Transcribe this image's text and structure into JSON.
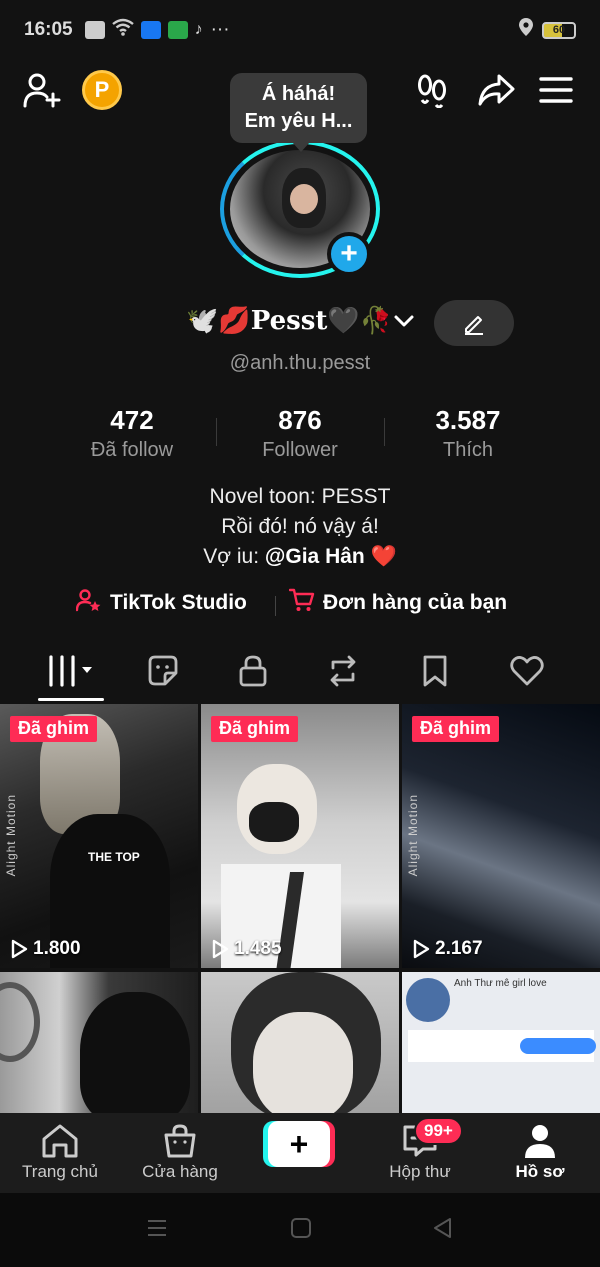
{
  "status_bar": {
    "time": "16:05",
    "more": "···",
    "battery": "60"
  },
  "tooltip": {
    "line1": "Á háhá!",
    "line2": "Em yêu H..."
  },
  "profile": {
    "display_name": "🕊️💋Pesst🖤🥀",
    "handle": "@anh.thu.pesst",
    "coin_label": "P"
  },
  "stats": [
    {
      "value": "472",
      "label": "Đã follow"
    },
    {
      "value": "876",
      "label": "Follower"
    },
    {
      "value": "3.587",
      "label": "Thích"
    }
  ],
  "bio": {
    "line1": "Novel toon: PESST",
    "line2": "Rồi đó! nó vậy á!",
    "line3_prefix": "Vợ iu: ",
    "line3_mention": "@Gia Hân",
    "line3_suffix": " ❤️"
  },
  "links": {
    "studio": "TikTok Studio",
    "orders": "Đơn hàng của bạn"
  },
  "tabs": [
    "videos-tab",
    "stickers-tab",
    "private-tab",
    "reposts-tab",
    "saved-tab",
    "liked-tab"
  ],
  "videos": [
    {
      "pinned_label": "Đã ghim",
      "views": "1.800",
      "side_text": "Alight Motion",
      "overlay": "THE TOP"
    },
    {
      "pinned_label": "Đã ghim",
      "views": "1.485"
    },
    {
      "pinned_label": "Đã ghim",
      "views": "2.167",
      "side_text": "Alight Motion"
    },
    {},
    {},
    {
      "caption": "Anh Thư mê girl love"
    }
  ],
  "bottom_nav": {
    "home": "Trang chủ",
    "shop": "Cửa hàng",
    "create": "+",
    "inbox": "Hộp thư",
    "inbox_badge": "99+",
    "profile": "Hồ sơ"
  },
  "colors": {
    "accent": "#fe2c55",
    "cyan": "#25f4ee",
    "avatar_plus": "#20a8ea"
  }
}
